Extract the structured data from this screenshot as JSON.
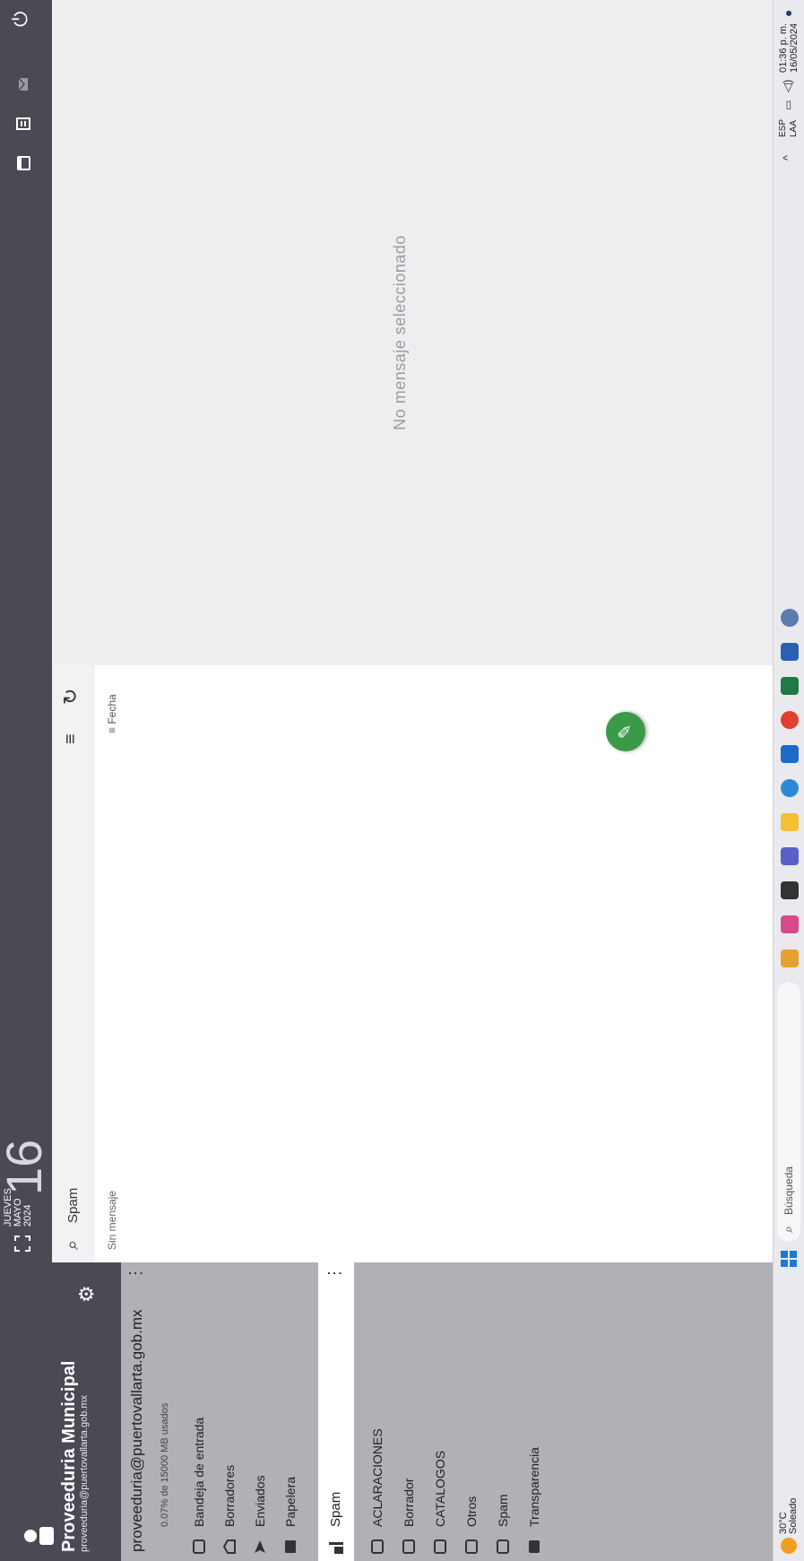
{
  "account": {
    "name": "Proveeduria Municipal",
    "email": "proveeduria@puertovallarta.gob.mx",
    "row_email": "proveeduria@puertovallarta.gob.mx",
    "quota": "0.07% de 15000 MB usados"
  },
  "folders": [
    {
      "label": "Bandeja de entrada",
      "icon": "inbox-icon"
    },
    {
      "label": "Borradores",
      "icon": "drafts-icon"
    },
    {
      "label": "Enviados",
      "icon": "sent-icon"
    },
    {
      "label": "Papelera",
      "icon": "trash-icon"
    }
  ],
  "selected_folder": {
    "label": "Spam",
    "icon": "spam-icon"
  },
  "subfolders": [
    {
      "label": "ACLARACIONES"
    },
    {
      "label": "Borrador"
    },
    {
      "label": "CATALOGOS"
    },
    {
      "label": "Otros"
    },
    {
      "label": "Spam"
    },
    {
      "label": "Transparencia"
    }
  ],
  "date": {
    "weekday": "JUEVES",
    "month": "MAYO",
    "year": "2024",
    "day": "16"
  },
  "search": {
    "label": "Spam"
  },
  "list": {
    "empty": "Sin mensaje",
    "sort": "Fecha"
  },
  "reading": {
    "empty": "No mensaje seleccionado"
  },
  "taskbar": {
    "weather_temp": "30°C",
    "weather_desc": "Soleado",
    "search_placeholder": "Búsqueda",
    "lang1": "ESP",
    "lang2": "LAA",
    "time": "01:36 p. m.",
    "date": "16/05/2024"
  },
  "colors": {
    "header": "#4a4a54",
    "sidebar": "#b1b1b5",
    "compose": "#3a9a48"
  }
}
